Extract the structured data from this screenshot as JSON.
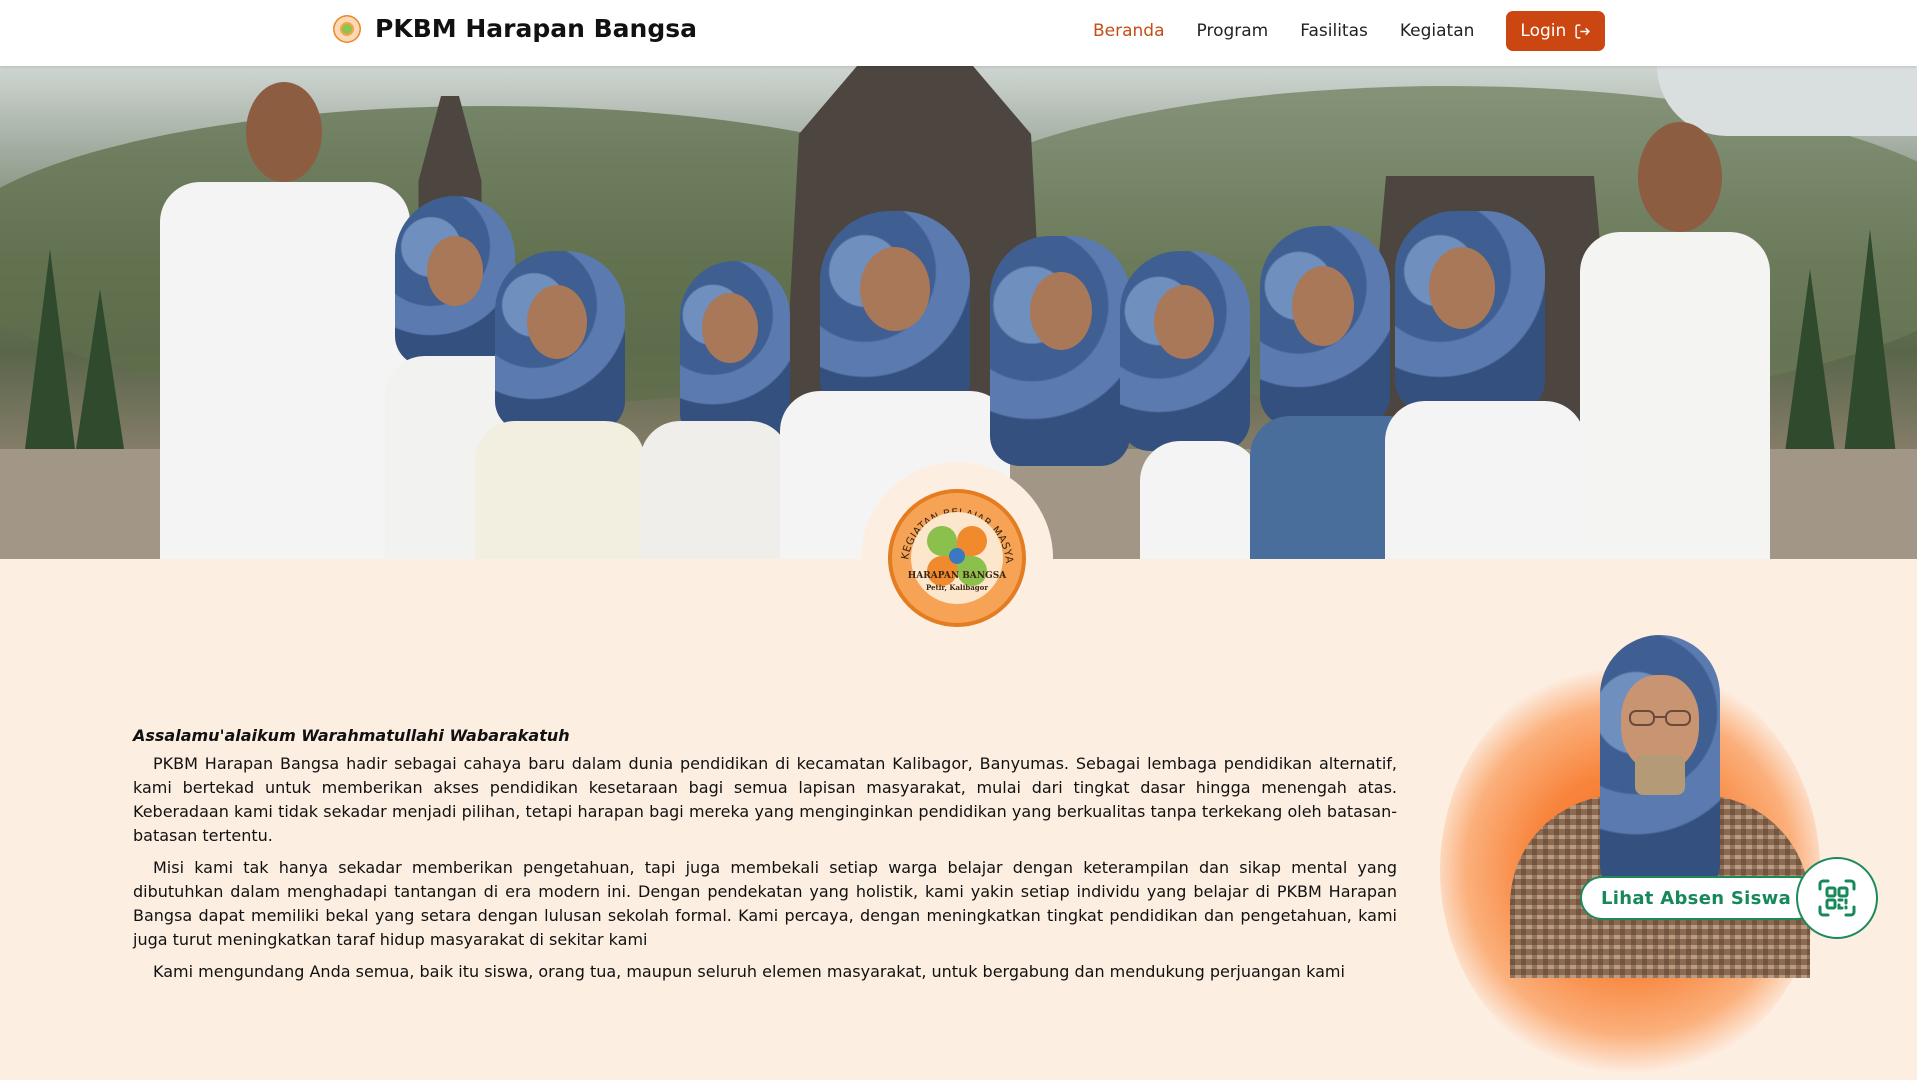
{
  "brand": {
    "name": "PKBM Harapan Bangsa"
  },
  "nav": {
    "items": [
      "Beranda",
      "Program",
      "Fasilitas",
      "Kegiatan"
    ],
    "active": "Beranda",
    "login_label": "Login"
  },
  "logo": {
    "arc_text": "PUSAT KEGIATAN BELAJAR MASYARAKAT",
    "name": "HARAPAN BANGSA",
    "location": "Petir, Kalibagor"
  },
  "welcome": {
    "greeting": "Assalamu'alaikum Warahmatullahi Wabarakatuh",
    "paragraphs": [
      "PKBM Harapan Bangsa hadir sebagai cahaya baru dalam dunia pendidikan di kecamatan Kalibagor, Banyumas. Sebagai lembaga pendidikan alternatif, kami bertekad untuk memberikan akses pendidikan kesetaraan bagi semua lapisan masyarakat, mulai dari tingkat dasar hingga menengah atas. Keberadaan kami tidak sekadar menjadi pilihan, tetapi harapan bagi mereka yang menginginkan pendidikan yang berkualitas tanpa terkekang oleh batasan-batasan tertentu.",
      "Misi kami tak hanya sekadar memberikan pengetahuan, tapi juga membekali setiap warga belajar dengan keterampilan dan sikap mental yang dibutuhkan dalam menghadapi tantangan di era modern ini. Dengan pendekatan yang holistik, kami yakin setiap individu yang belajar di PKBM Harapan Bangsa dapat memiliki bekal yang setara dengan lulusan sekolah formal. Kami percaya, dengan meningkatkan tingkat pendidikan dan pengetahuan, kami juga turut meningkatkan taraf hidup masyarakat di sekitar kami",
      "Kami mengundang Anda semua, baik itu siswa, orang tua, maupun seluruh elemen masyarakat, untuk bergabung dan mendukung perjuangan kami"
    ]
  },
  "absen": {
    "label": "Lihat Absen Siswa",
    "icon": "qr-scan-icon"
  },
  "colors": {
    "accent": "#cc4612",
    "green": "#17885a",
    "background": "#fdeee2"
  }
}
